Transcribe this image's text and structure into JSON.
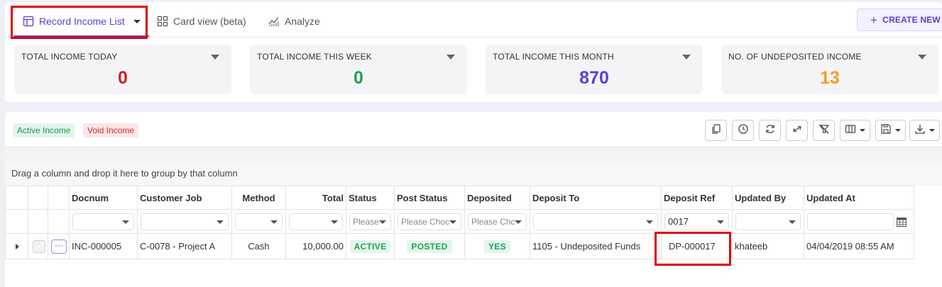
{
  "tabs": {
    "list_label": "Record Income List",
    "card_label": "Card view (beta)",
    "analyze_label": "Analyze"
  },
  "create_button": "CREATE NEW",
  "stats": [
    {
      "label": "TOTAL INCOME TODAY",
      "value": "0",
      "color": "#cc1f2a"
    },
    {
      "label": "TOTAL INCOME THIS WEEK",
      "value": "0",
      "color": "#22a04b"
    },
    {
      "label": "TOTAL INCOME THIS MONTH",
      "value": "870",
      "color": "#5b3fd1"
    },
    {
      "label": "NO. OF UNDEPOSITED INCOME",
      "value": "13",
      "color": "#f0a01e"
    }
  ],
  "filters": {
    "active": "Active Income",
    "void": "Void Income"
  },
  "group_hint": "Drag a column and drop it here to group by that column",
  "columns": [
    "Docnum",
    "Customer Job",
    "Method",
    "Total",
    "Status",
    "Post Status",
    "Deposited",
    "Deposit To",
    "Deposit Ref",
    "Updated By",
    "Updated At"
  ],
  "filter_row": {
    "status_placeholder": "Please",
    "post_status_placeholder": "Please Choc",
    "deposited_placeholder": "Please Chc",
    "deposit_ref_value": "0017"
  },
  "rows": [
    {
      "docnum": "INC-000005",
      "customer_job": "C-0078 - Project A",
      "method": "Cash",
      "total": "10,000.00",
      "status": "ACTIVE",
      "post_status": "POSTED",
      "deposited": "YES",
      "deposit_to": "1105 - Undeposited Funds",
      "deposit_ref": "DP-000017",
      "updated_by": "khateeb",
      "updated_at": "04/04/2019 08:55 AM"
    }
  ],
  "row_menu_glyph": "···",
  "colors": {
    "accent": "#5b3fd1",
    "highlight": "#e00000"
  },
  "icons": [
    "table-icon",
    "grid-icon",
    "chart-icon",
    "plus-icon",
    "copy-icon",
    "clock-icon",
    "refresh-icon",
    "swap-icon",
    "filter-clear-icon",
    "columns-icon",
    "save-icon",
    "download-icon",
    "calendar-icon"
  ]
}
